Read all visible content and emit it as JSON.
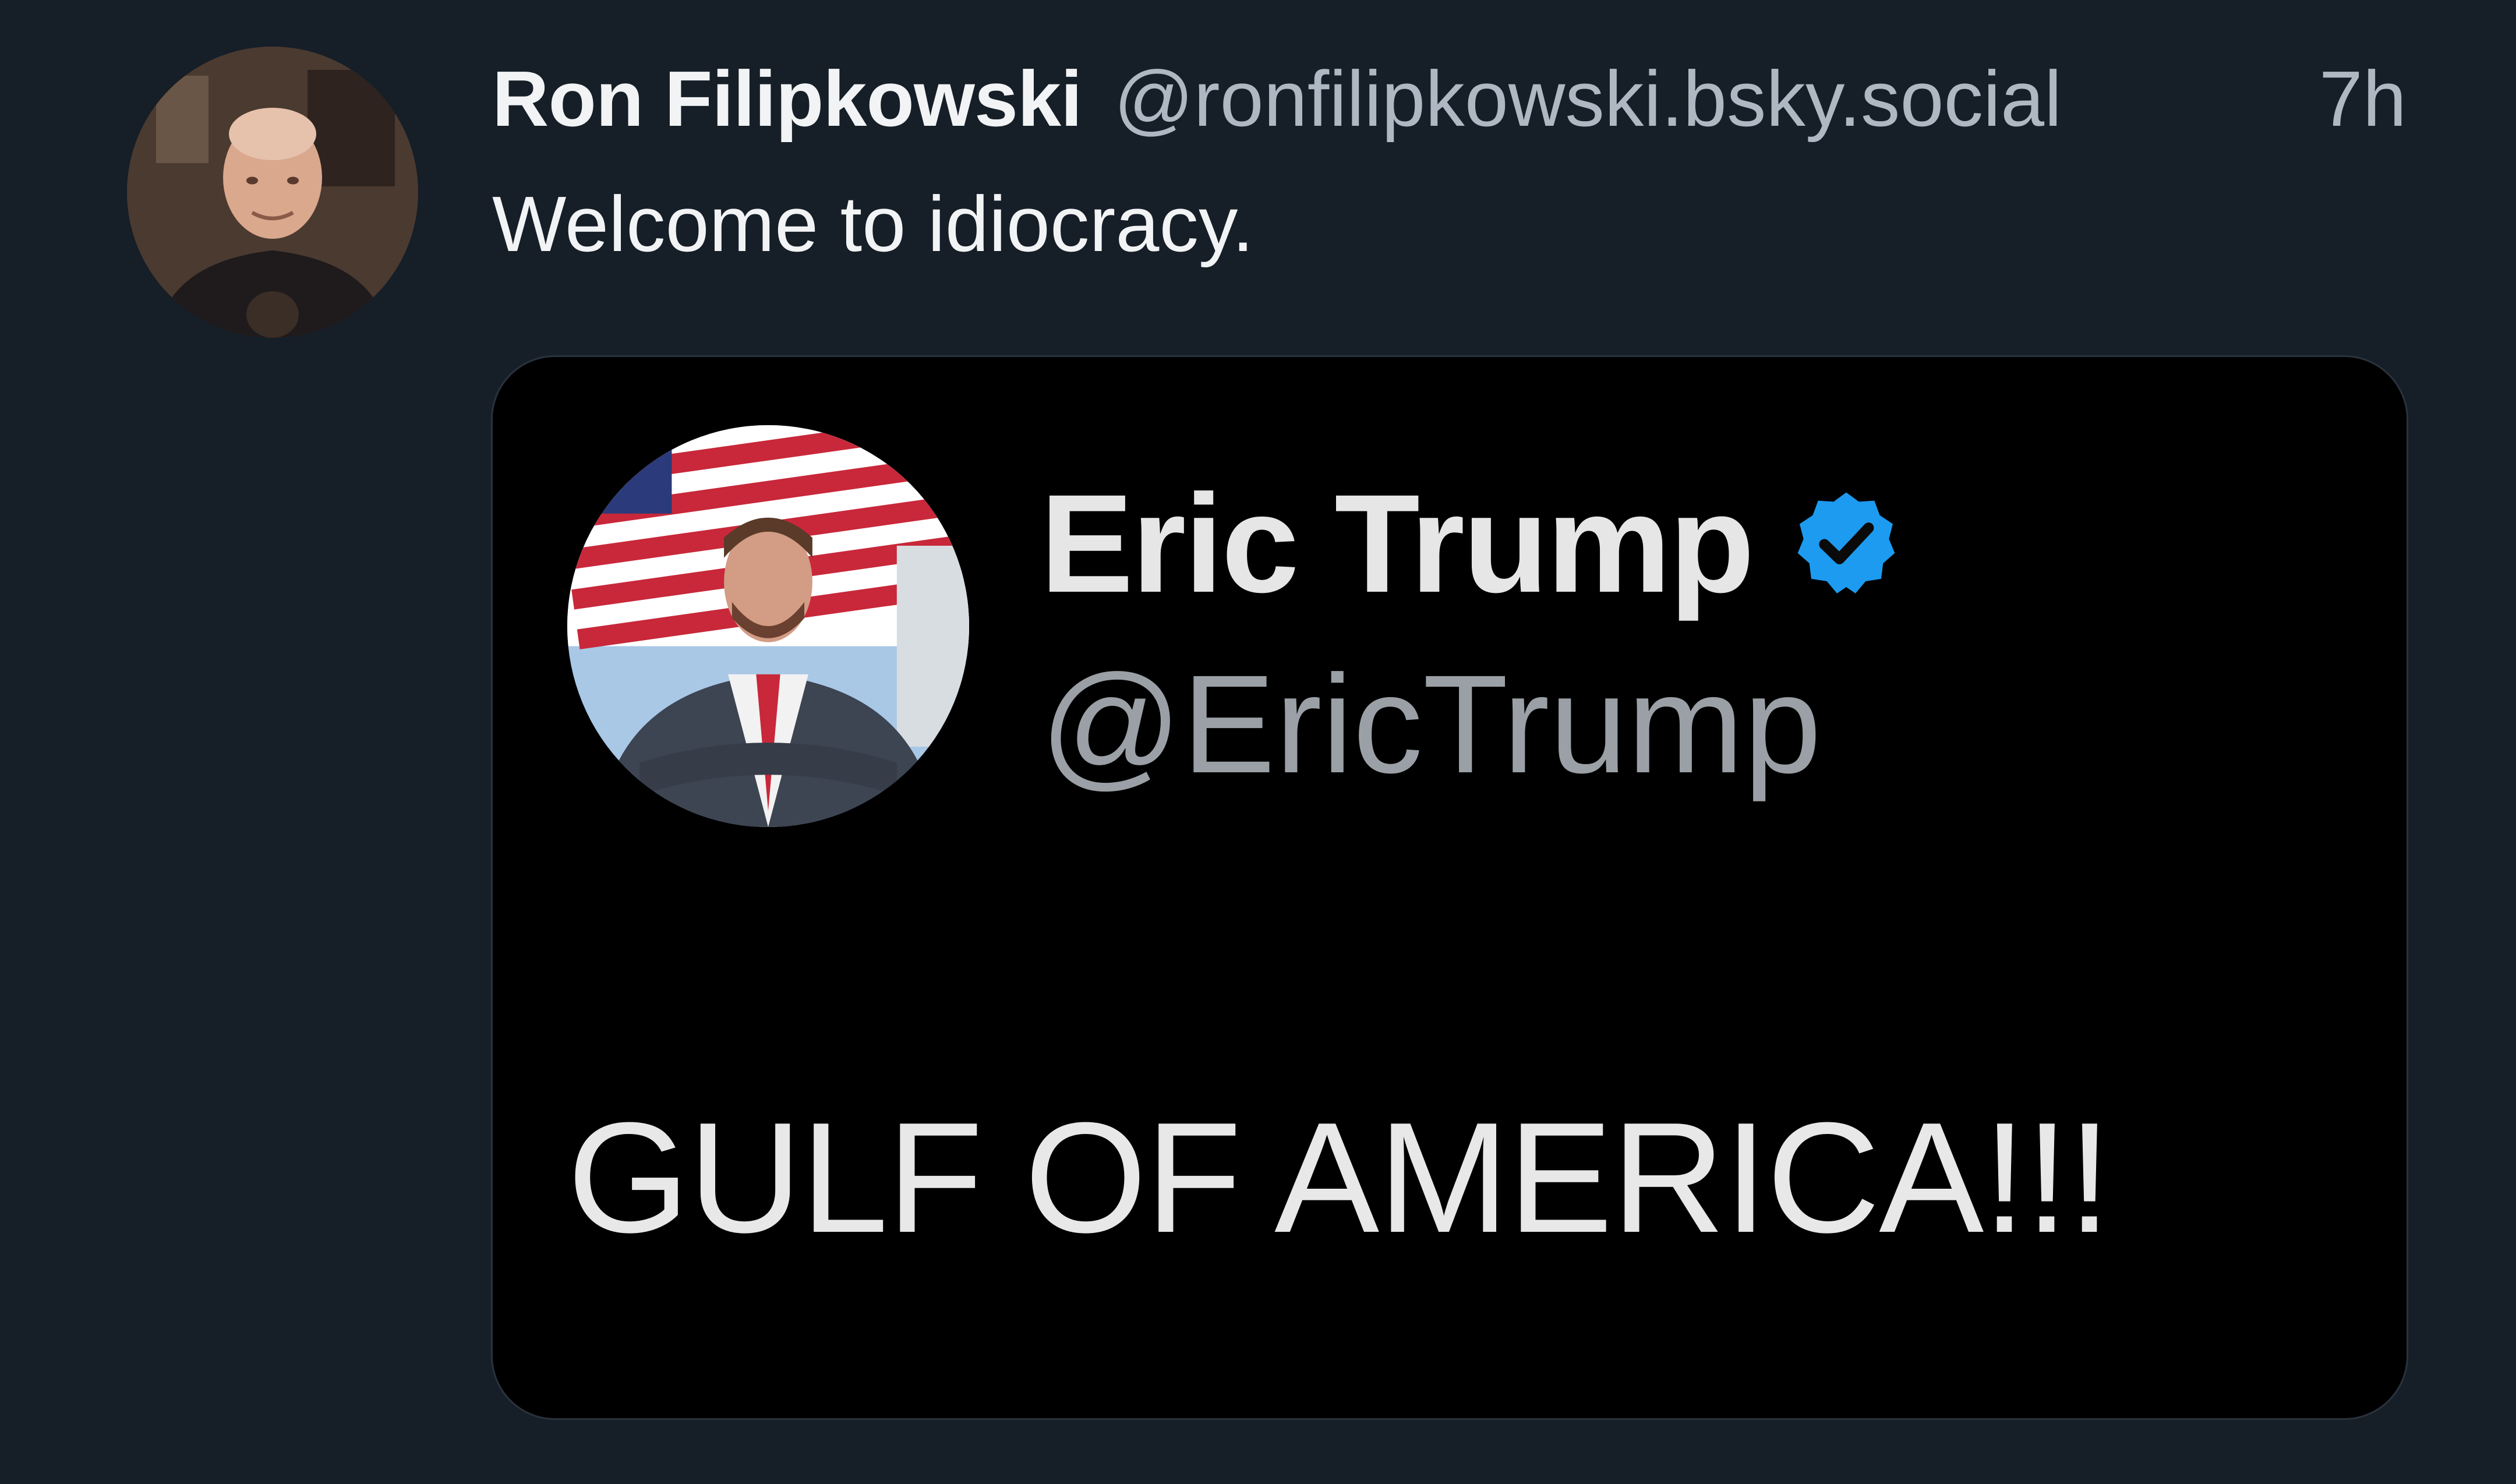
{
  "post": {
    "author": {
      "display_name": "Ron Filipkowski",
      "handle": "@ronfilipkowski.bsky.social",
      "avatar_icon": "author-avatar"
    },
    "timestamp": "7h",
    "text": "Welcome to idiocracy.",
    "embed": {
      "display_name": "Eric Trump",
      "handle": "@EricTrump",
      "verified": true,
      "verified_color": "#1d9bf0",
      "text": "GULF OF AMERICA!!!",
      "avatar_icon": "embedded-author-avatar"
    }
  },
  "colors": {
    "background": "#161e27",
    "embed_background": "#000000",
    "primary_text": "#f1f3f5",
    "secondary_text": "#aeb8c3"
  }
}
